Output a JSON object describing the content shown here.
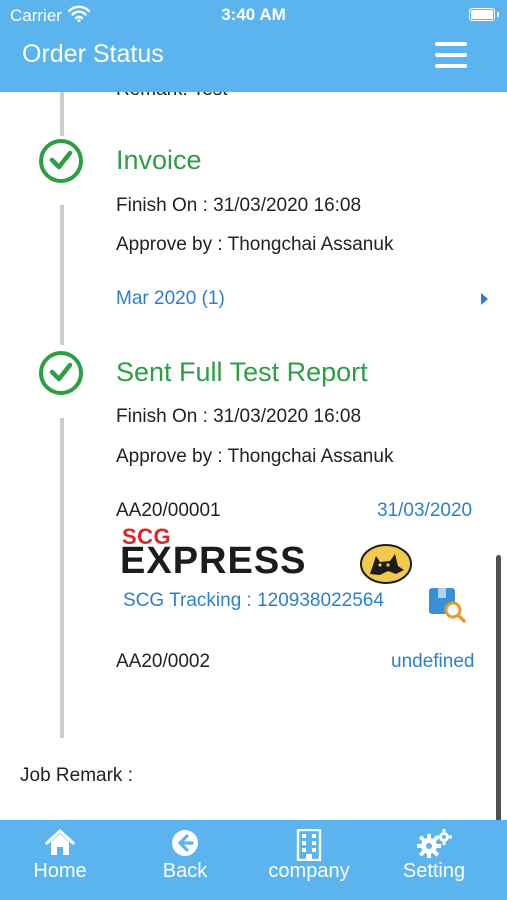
{
  "status_bar": {
    "carrier": "Carrier",
    "time": "3:40 AM"
  },
  "header": {
    "title": "Order Status",
    "menu_icon": "hamburger-menu-icon"
  },
  "timeline": {
    "previous_item_peek": "Remark: Test",
    "steps": [
      {
        "title": "Invoice",
        "finish_on": "Finish On : 31/03/2020 16:08",
        "approve_by": "Approve by : Thongchai Assanuk",
        "link": "Mar 2020 (1)"
      },
      {
        "title": "Sent Full Test Report",
        "finish_on": "Finish On : 31/03/2020 16:08",
        "approve_by": "Approve by : Thongchai Assanuk",
        "shipments": [
          {
            "doc_no": "AA20/00001",
            "date": "31/03/2020",
            "carrier_logo": {
              "top": "SCG",
              "bottom": "EXPRESS"
            },
            "tracking": "SCG Tracking : 120938022564"
          },
          {
            "doc_no": "AA20/0002",
            "date": "undefined"
          }
        ]
      }
    ]
  },
  "job_remark": {
    "label": "Job Remark :"
  },
  "tab_bar": {
    "items": [
      {
        "label": "Home",
        "icon": "home-icon"
      },
      {
        "label": "Back",
        "icon": "back-arrow-icon"
      },
      {
        "label": "company",
        "icon": "building-icon"
      },
      {
        "label": "Setting",
        "icon": "gears-icon"
      }
    ]
  },
  "colors": {
    "accent": "#5bb4ee",
    "success_green": "#2e9e44",
    "link_blue": "#2b7fcf"
  }
}
